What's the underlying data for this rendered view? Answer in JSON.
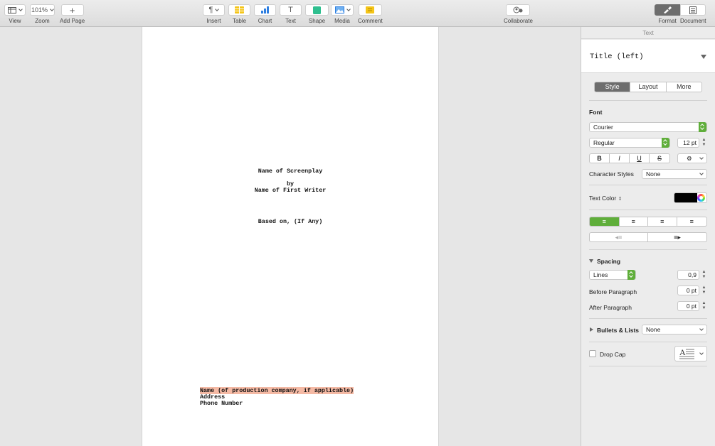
{
  "toolbar": {
    "view": {
      "label": "View"
    },
    "zoom": {
      "value": "101%",
      "label": "Zoom"
    },
    "add_page": {
      "label": "Add Page"
    },
    "insert": {
      "label": "Insert"
    },
    "table": {
      "label": "Table"
    },
    "chart": {
      "label": "Chart"
    },
    "text": {
      "label": "Text"
    },
    "shape": {
      "label": "Shape"
    },
    "media": {
      "label": "Media"
    },
    "comment": {
      "label": "Comment"
    },
    "collaborate": {
      "label": "Collaborate"
    },
    "format": {
      "label": "Format"
    },
    "document": {
      "label": "Document"
    }
  },
  "document": {
    "title": "Name of Screenplay",
    "by": "by",
    "writer": "Name of First Writer",
    "based_on": "Based on, (If Any)",
    "company": "Name (of production company, if applicable)",
    "address": "Address",
    "phone": "Phone Number",
    "highlight_color": "#f4b9a4"
  },
  "sidebar": {
    "header": "Text",
    "paragraph_style": "Title (left)",
    "tabs": [
      "Style",
      "Layout",
      "More"
    ],
    "active_tab": "Style",
    "font_section": "Font",
    "font_family": "Courier",
    "font_typeface": "Regular",
    "font_size": "12 pt",
    "text_style_buttons": [
      "B",
      "I",
      "U",
      "S"
    ],
    "character_styles_label": "Character Styles",
    "character_styles_value": "None",
    "text_color_label": "Text Color",
    "text_color": "#000000",
    "spacing_label": "Spacing",
    "spacing_mode": "Lines",
    "spacing_value": "0,9",
    "before_paragraph_label": "Before Paragraph",
    "before_paragraph_value": "0 pt",
    "after_paragraph_label": "After Paragraph",
    "after_paragraph_value": "0 pt",
    "bullets_label": "Bullets & Lists",
    "bullets_value": "None",
    "drop_cap_label": "Drop Cap",
    "accent_color": "#5fae3a"
  }
}
